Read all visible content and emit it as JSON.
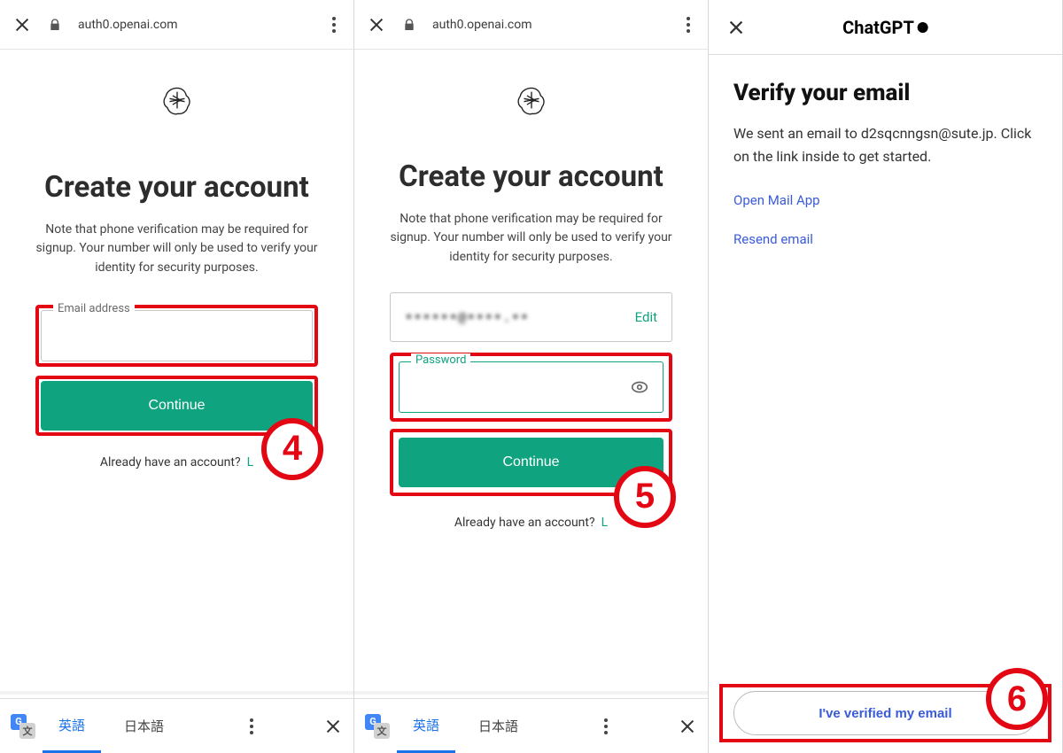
{
  "panel1": {
    "url": "auth0.openai.com",
    "title": "Create your account",
    "note": "Note that phone verification may be required for signup. Your number will only be used to verify your identity for security purposes.",
    "email_label": "Email address",
    "continue": "Continue",
    "already": "Already have an account?",
    "login": "L",
    "badge": "4",
    "lang_en": "英語",
    "lang_jp": "日本語"
  },
  "panel2": {
    "url": "auth0.openai.com",
    "title": "Create your account",
    "note": "Note that phone verification may be required for signup. Your number will only be used to verify your identity for security purposes.",
    "email_masked": "••••••@••••.••",
    "edit": "Edit",
    "pw_label": "Password",
    "continue": "Continue",
    "already": "Already have an account?",
    "login": "L",
    "badge": "5",
    "lang_en": "英語",
    "lang_jp": "日本語"
  },
  "panel3": {
    "brand": "ChatGPT",
    "h1": "Verify your email",
    "body": "We sent an email to d2sqcnngsn@sute.jp. Click on the link inside to get started.",
    "open_mail": "Open Mail App",
    "resend": "Resend email",
    "verified": "I've verified my email",
    "badge": "6"
  }
}
